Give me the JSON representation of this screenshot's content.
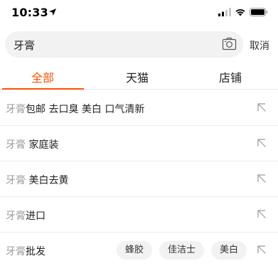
{
  "status": {
    "time": "10:33"
  },
  "search": {
    "query": "牙膏",
    "cancel_label": "取消"
  },
  "tabs": [
    {
      "label": "全部",
      "active": true
    },
    {
      "label": "天猫",
      "active": false
    },
    {
      "label": "店铺",
      "active": false
    }
  ],
  "suggestions": [
    {
      "keyword": "牙膏",
      "suffix": "包邮 去口臭 美白 口气清新",
      "chips": []
    },
    {
      "keyword": "牙膏",
      "suffix": " 家庭装",
      "chips": []
    },
    {
      "keyword": "牙膏",
      "suffix": " 美白去黄",
      "chips": []
    },
    {
      "keyword": "牙膏",
      "suffix": "进口",
      "chips": []
    },
    {
      "keyword": "牙膏",
      "suffix": "批发",
      "chips": [
        "蜂胶",
        "佳洁士",
        "美白"
      ]
    }
  ],
  "icons": {
    "location": "location-arrow-icon",
    "signal": "cellular-signal-icon",
    "wifi": "wifi-icon",
    "battery": "battery-icon",
    "camera": "camera-icon",
    "fill": "arrow-up-left-icon"
  },
  "colors": {
    "accent": "#ff5000",
    "keyword_gray": "#999999",
    "field_bg": "#f2f2f2"
  }
}
